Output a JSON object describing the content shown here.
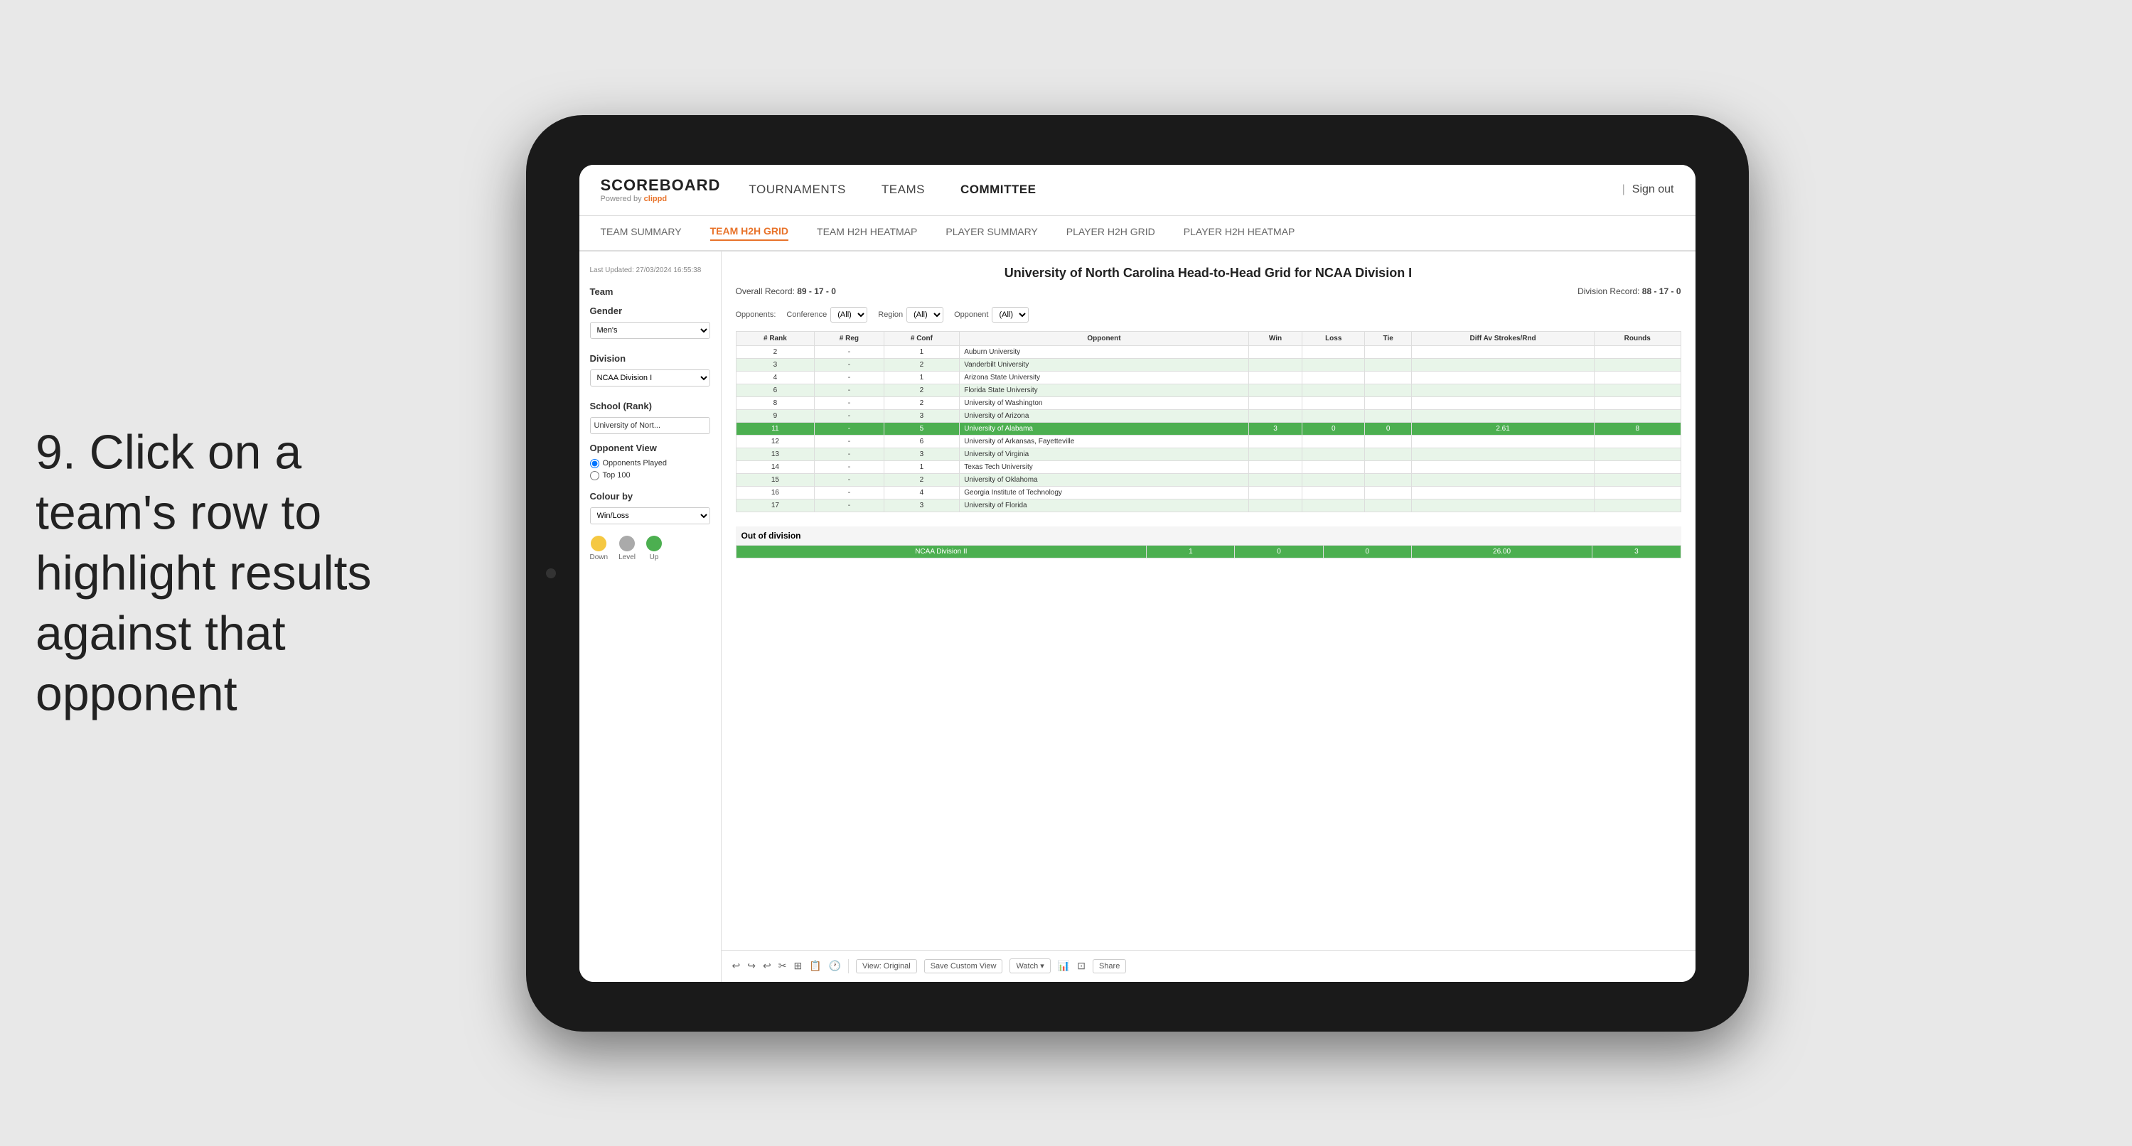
{
  "instruction": {
    "step": "9.",
    "text": "Click on a team's row to highlight results against that opponent"
  },
  "nav": {
    "logo": "SCOREBOARD",
    "powered_by": "Powered by",
    "clippd": "clippd",
    "items": [
      {
        "label": "TOURNAMENTS",
        "active": false
      },
      {
        "label": "TEAMS",
        "active": false
      },
      {
        "label": "COMMITTEE",
        "active": true
      }
    ],
    "sign_out": "Sign out"
  },
  "sub_nav": {
    "items": [
      {
        "label": "TEAM SUMMARY",
        "active": false
      },
      {
        "label": "TEAM H2H GRID",
        "active": true
      },
      {
        "label": "TEAM H2H HEATMAP",
        "active": false
      },
      {
        "label": "PLAYER SUMMARY",
        "active": false
      },
      {
        "label": "PLAYER H2H GRID",
        "active": false
      },
      {
        "label": "PLAYER H2H HEATMAP",
        "active": false
      }
    ]
  },
  "sidebar": {
    "timestamp": "Last Updated: 27/03/2024\n16:55:38",
    "team_label": "Team",
    "gender_label": "Gender",
    "gender_value": "Men's",
    "division_label": "Division",
    "division_value": "NCAA Division I",
    "school_label": "School (Rank)",
    "school_value": "University of Nort...",
    "opponent_view_label": "Opponent View",
    "radio_opponents": "Opponents Played",
    "radio_top100": "Top 100",
    "colour_by_label": "Colour by",
    "colour_by_value": "Win/Loss",
    "legend": [
      {
        "color": "#f5c842",
        "label": "Down"
      },
      {
        "color": "#aaaaaa",
        "label": "Level"
      },
      {
        "color": "#4caf50",
        "label": "Up"
      }
    ]
  },
  "grid": {
    "title": "University of North Carolina Head-to-Head Grid for NCAA Division I",
    "overall_record_label": "Overall Record:",
    "overall_record": "89 - 17 - 0",
    "division_record_label": "Division Record:",
    "division_record": "88 - 17 - 0",
    "filters": {
      "opponents_label": "Opponents:",
      "conference_label": "Conference",
      "conference_value": "(All)",
      "region_label": "Region",
      "region_value": "(All)",
      "opponent_label": "Opponent",
      "opponent_value": "(All)"
    },
    "columns": [
      "# Rank",
      "# Reg",
      "# Conf",
      "Opponent",
      "Win",
      "Loss",
      "Tie",
      "Diff Av Strokes/Rnd",
      "Rounds"
    ],
    "rows": [
      {
        "rank": "2",
        "reg": "-",
        "conf": "1",
        "opponent": "Auburn University",
        "win": "",
        "loss": "",
        "tie": "",
        "diff": "",
        "rounds": "",
        "style": "normal"
      },
      {
        "rank": "3",
        "reg": "-",
        "conf": "2",
        "opponent": "Vanderbilt University",
        "win": "",
        "loss": "",
        "tie": "",
        "diff": "",
        "rounds": "",
        "style": "light-green"
      },
      {
        "rank": "4",
        "reg": "-",
        "conf": "1",
        "opponent": "Arizona State University",
        "win": "",
        "loss": "",
        "tie": "",
        "diff": "",
        "rounds": "",
        "style": "normal"
      },
      {
        "rank": "6",
        "reg": "-",
        "conf": "2",
        "opponent": "Florida State University",
        "win": "",
        "loss": "",
        "tie": "",
        "diff": "",
        "rounds": "",
        "style": "light-green"
      },
      {
        "rank": "8",
        "reg": "-",
        "conf": "2",
        "opponent": "University of Washington",
        "win": "",
        "loss": "",
        "tie": "",
        "diff": "",
        "rounds": "",
        "style": "normal"
      },
      {
        "rank": "9",
        "reg": "-",
        "conf": "3",
        "opponent": "University of Arizona",
        "win": "",
        "loss": "",
        "tie": "",
        "diff": "",
        "rounds": "",
        "style": "light-green"
      },
      {
        "rank": "11",
        "reg": "-",
        "conf": "5",
        "opponent": "University of Alabama",
        "win": "3",
        "loss": "0",
        "tie": "0",
        "diff": "2.61",
        "rounds": "8",
        "style": "highlighted"
      },
      {
        "rank": "12",
        "reg": "-",
        "conf": "6",
        "opponent": "University of Arkansas, Fayetteville",
        "win": "",
        "loss": "",
        "tie": "",
        "diff": "",
        "rounds": "",
        "style": "normal"
      },
      {
        "rank": "13",
        "reg": "-",
        "conf": "3",
        "opponent": "University of Virginia",
        "win": "",
        "loss": "",
        "tie": "",
        "diff": "",
        "rounds": "",
        "style": "light-green"
      },
      {
        "rank": "14",
        "reg": "-",
        "conf": "1",
        "opponent": "Texas Tech University",
        "win": "",
        "loss": "",
        "tie": "",
        "diff": "",
        "rounds": "",
        "style": "normal"
      },
      {
        "rank": "15",
        "reg": "-",
        "conf": "2",
        "opponent": "University of Oklahoma",
        "win": "",
        "loss": "",
        "tie": "",
        "diff": "",
        "rounds": "",
        "style": "light-green"
      },
      {
        "rank": "16",
        "reg": "-",
        "conf": "4",
        "opponent": "Georgia Institute of Technology",
        "win": "",
        "loss": "",
        "tie": "",
        "diff": "",
        "rounds": "",
        "style": "normal"
      },
      {
        "rank": "17",
        "reg": "-",
        "conf": "3",
        "opponent": "University of Florida",
        "win": "",
        "loss": "",
        "tie": "",
        "diff": "",
        "rounds": "",
        "style": "light-green"
      }
    ],
    "out_of_division_label": "Out of division",
    "out_of_division_row": {
      "division": "NCAA Division II",
      "win": "1",
      "loss": "0",
      "tie": "0",
      "diff": "26.00",
      "rounds": "3",
      "style": "highlighted"
    }
  },
  "toolbar": {
    "view_label": "View: Original",
    "save_custom": "Save Custom View",
    "watch": "Watch ▾",
    "share": "Share"
  }
}
